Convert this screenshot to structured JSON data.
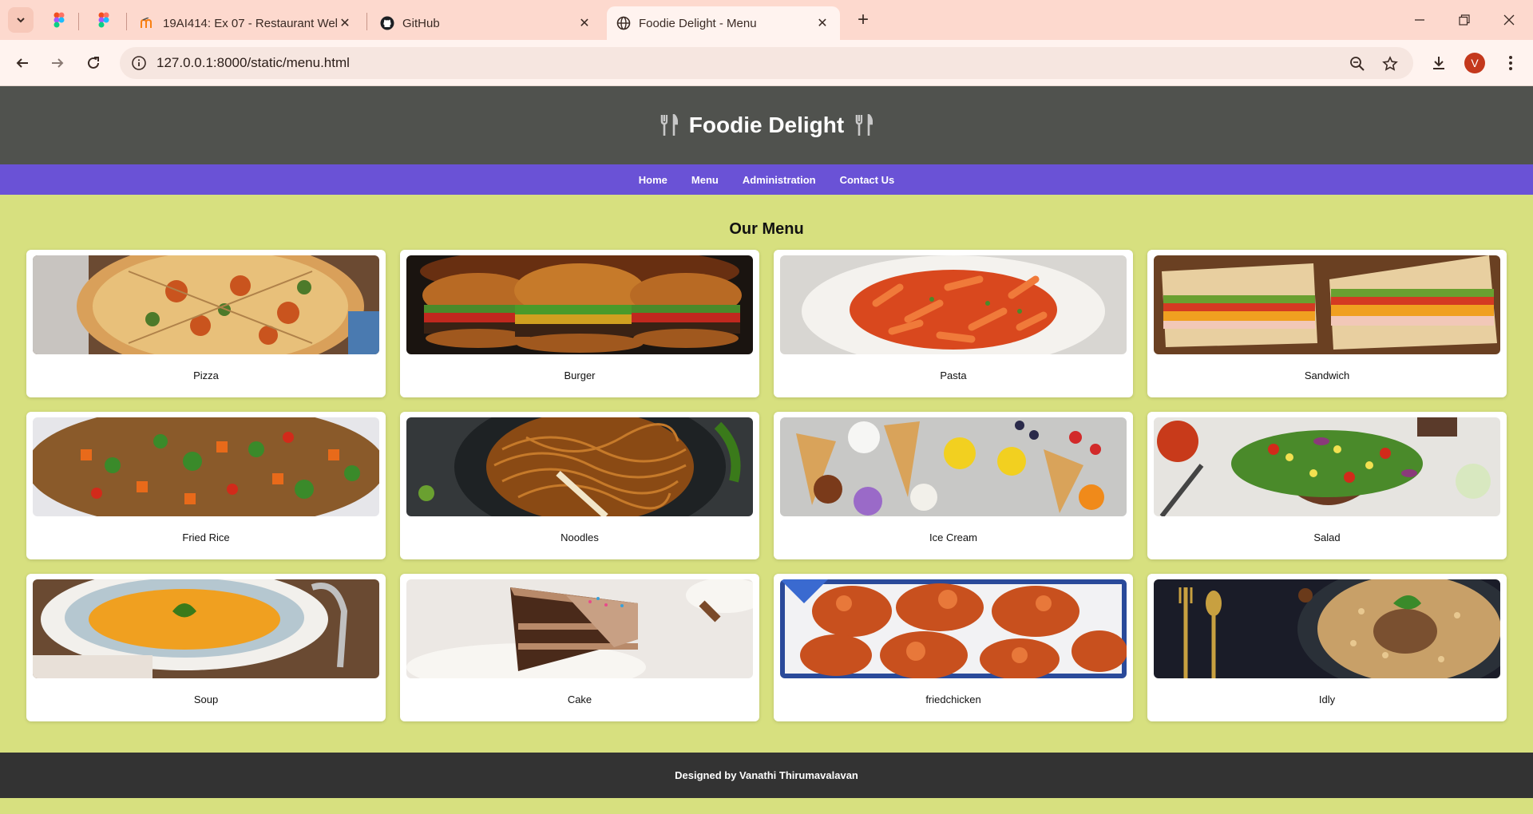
{
  "browser": {
    "tabs": [
      {
        "title": "19AI414: Ex 07 - Restaurant Wel"
      },
      {
        "title": "GitHub"
      },
      {
        "title": "Foodie Delight - Menu"
      }
    ],
    "url": "127.0.0.1:8000/static/menu.html",
    "profile_initial": "V",
    "colors": {
      "tabbar": "#fdd9ce",
      "toolbar": "#fff3ef",
      "avatar": "#c4381c"
    }
  },
  "site": {
    "title": "Foodie Delight",
    "nav": [
      "Home",
      "Menu",
      "Administration",
      "Contact Us"
    ],
    "section_title": "Our Menu",
    "items": [
      {
        "name": "Pizza"
      },
      {
        "name": "Burger"
      },
      {
        "name": "Pasta"
      },
      {
        "name": "Sandwich"
      },
      {
        "name": "Fried Rice"
      },
      {
        "name": "Noodles"
      },
      {
        "name": "Ice Cream"
      },
      {
        "name": "Salad"
      },
      {
        "name": "Soup"
      },
      {
        "name": "Cake"
      },
      {
        "name": "friedchicken"
      },
      {
        "name": "Idly"
      }
    ],
    "footer": "Designed by Vanathi Thirumavalavan",
    "colors": {
      "header": "#50524e",
      "nav": "#6a52d6",
      "page_bg": "#d7e07f",
      "footer": "#333333"
    }
  }
}
